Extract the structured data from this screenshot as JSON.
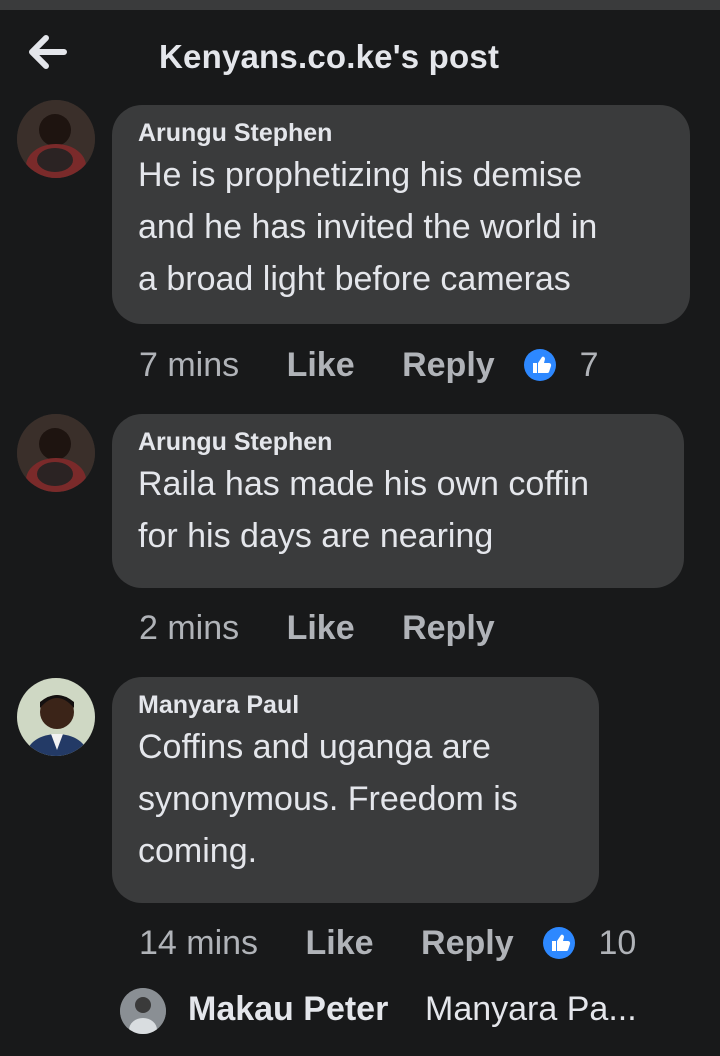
{
  "header": {
    "title": "Kenyans.co.ke's post",
    "back_icon": "arrow-left-icon"
  },
  "colors": {
    "background": "#18191a",
    "bubble": "#3a3b3c",
    "like_blue": "#2d88ff",
    "meta_text": "#b0b3b8"
  },
  "comments": [
    {
      "author": "Arungu Stephen",
      "lines": [
        "He is prophetizing his demise",
        "and he has invited the world in",
        "a broad light before cameras"
      ],
      "time": "7 mins",
      "like": "Like",
      "reply": "Reply",
      "reactions": "7"
    },
    {
      "author": "Arungu Stephen",
      "lines": [
        "Raila has made his own coffin",
        "for his days are nearing"
      ],
      "time": "2 mins",
      "like": "Like",
      "reply": "Reply",
      "reactions": null
    },
    {
      "author": "Manyara Paul",
      "lines": [
        "Coffins and uganga are",
        "synonymous. Freedom is",
        "coming."
      ],
      "time": "14 mins",
      "like": "Like",
      "reply": "Reply",
      "reactions": "10"
    }
  ],
  "reply_preview": {
    "author": "Makau Peter",
    "text": "Manyara Pa..."
  }
}
